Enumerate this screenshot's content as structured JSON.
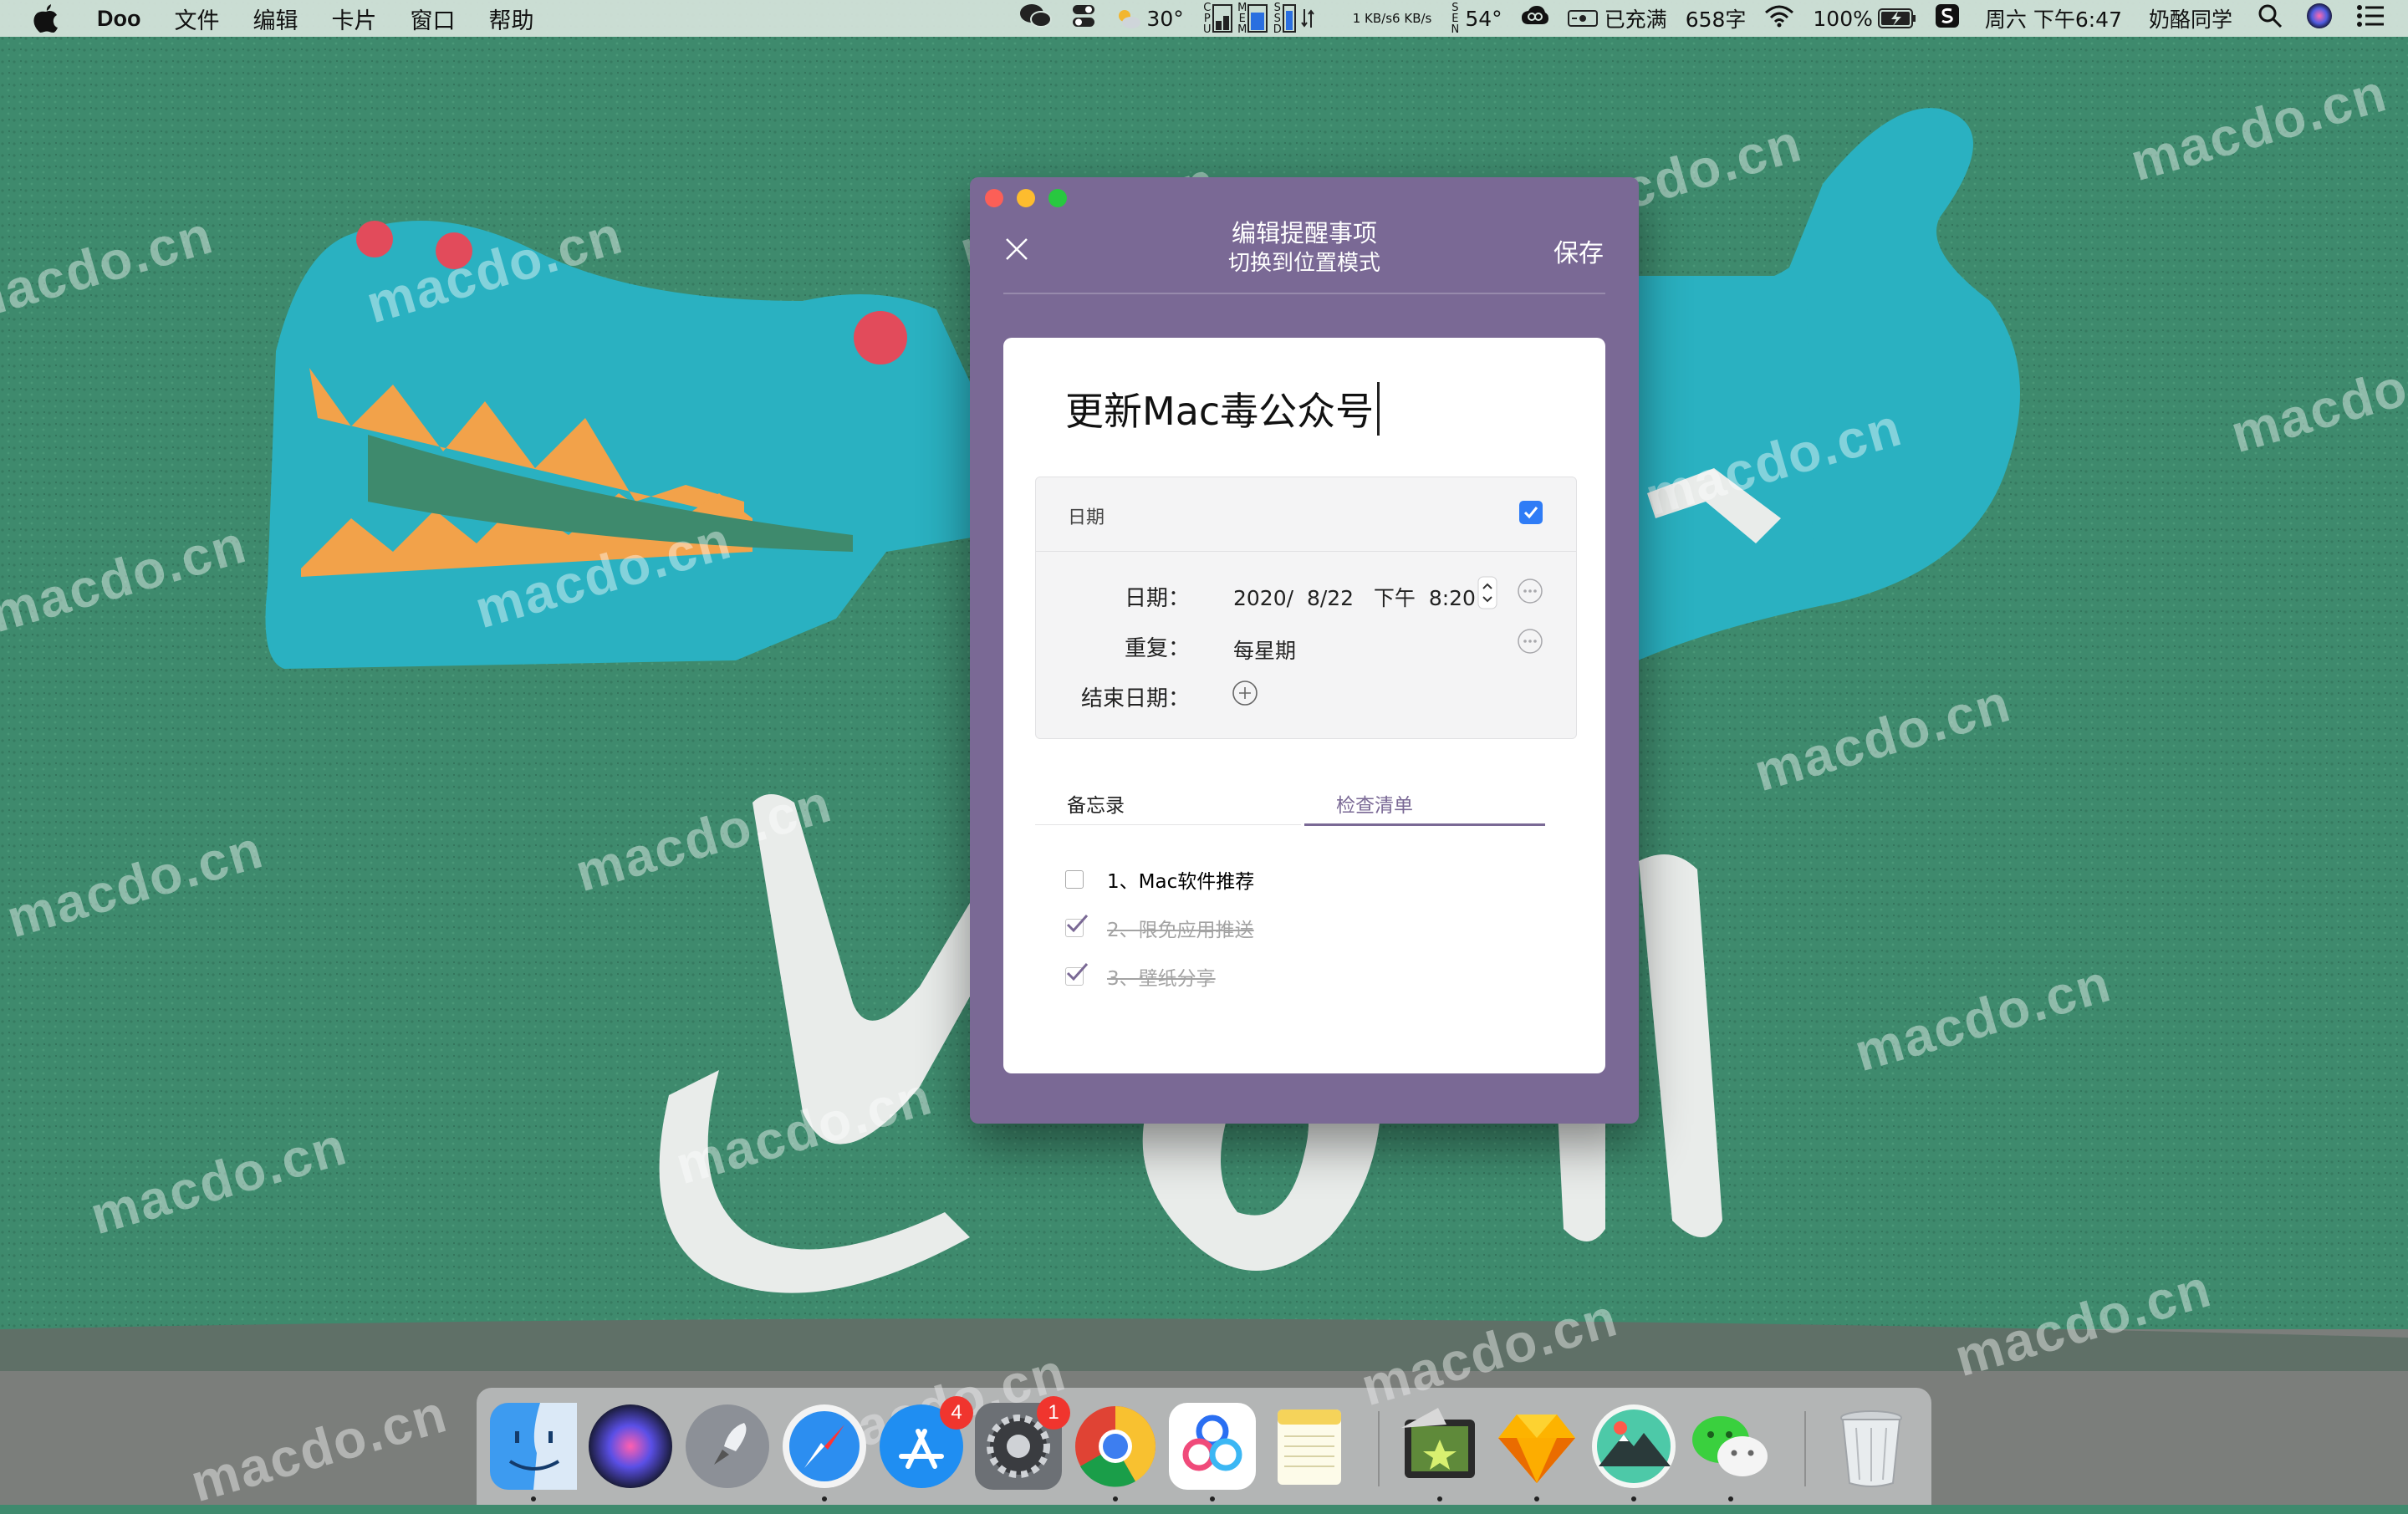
{
  "menubar": {
    "app_name": "Doo",
    "menus": [
      "文件",
      "编辑",
      "卡片",
      "窗口",
      "帮助"
    ],
    "weather": "30°",
    "net_up": "1 KB/s",
    "net_down": "6 KB/s",
    "sensor_temp": "54°",
    "charge_status": "已充满",
    "word_count": "658字",
    "battery": "100%",
    "datetime": "周六 下午6:47",
    "user": "奶酪同学"
  },
  "window": {
    "title": "编辑提醒事项",
    "subtitle": "切换到位置模式",
    "save_label": "保存",
    "task_title": "更新Mac毒公众号",
    "date_section": {
      "header": "日期",
      "enabled": true,
      "date_label": "日期：",
      "date_value": "2020/  8/22   下午  8:20",
      "repeat_label": "重复：",
      "repeat_value": "每星期",
      "end_date_label": "结束日期："
    },
    "tabs": {
      "memo": "备忘录",
      "checklist": "检查清单",
      "active": "checklist"
    },
    "checklist": [
      {
        "label": "1、Mac软件推荐",
        "done": false
      },
      {
        "label": "2、限免应用推送",
        "done": true
      },
      {
        "label": "3、壁纸分享",
        "done": true
      }
    ],
    "accent_color": "#7a6995"
  },
  "dock": {
    "badges": {
      "app_store": "4",
      "system_preferences": "1"
    }
  },
  "watermark_text": "macdo.cn"
}
